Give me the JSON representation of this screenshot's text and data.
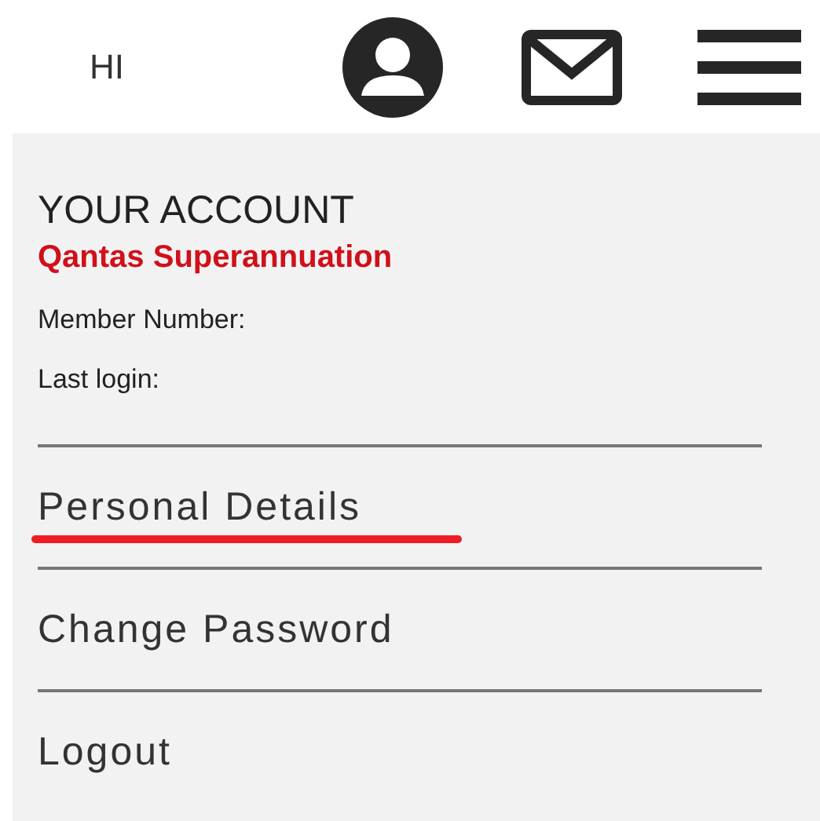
{
  "header": {
    "greeting": "HI"
  },
  "account": {
    "heading": "YOUR ACCOUNT",
    "fund": "Qantas Superannuation",
    "member_number_label": "Member Number:",
    "last_login_label": "Last login:"
  },
  "menu_items": [
    {
      "label": "Personal Details",
      "underlined": true
    },
    {
      "label": "Change Password",
      "underlined": false
    },
    {
      "label": "Logout",
      "underlined": false
    }
  ]
}
